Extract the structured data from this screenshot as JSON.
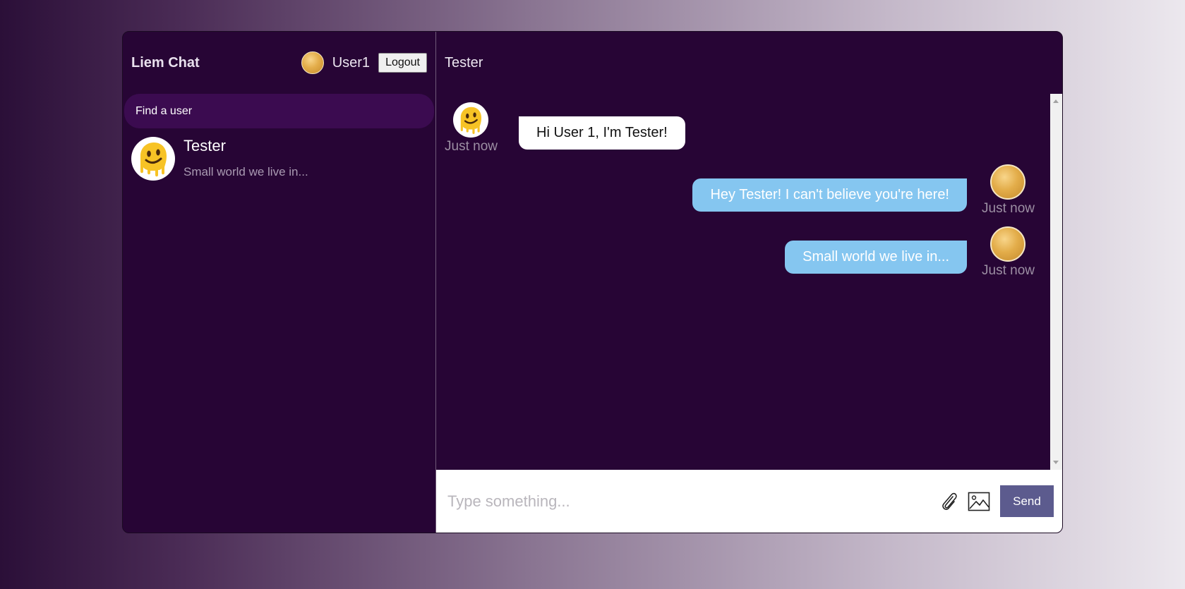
{
  "app": {
    "title": "Liem Chat"
  },
  "current_user": {
    "name": "User1",
    "logout_label": "Logout"
  },
  "search": {
    "placeholder": "Find a user"
  },
  "chats": [
    {
      "name": "Tester",
      "last_message": "Small world we live in..."
    }
  ],
  "active_chat": {
    "name": "Tester"
  },
  "messages": [
    {
      "from": "Tester",
      "owner": false,
      "text": "Hi User 1, I'm Tester!",
      "time": "Just now"
    },
    {
      "from": "User1",
      "owner": true,
      "text": "Hey Tester! I can't believe you're here!",
      "time": "Just now"
    },
    {
      "from": "User1",
      "owner": true,
      "text": "Small world we live in...",
      "time": "Just now"
    }
  ],
  "composer": {
    "placeholder": "Type something...",
    "send_label": "Send"
  },
  "icons": [
    "paperclip-icon",
    "image-icon",
    "melting-face-icon"
  ],
  "colors": {
    "panel": "#270535",
    "search_bg": "#3b0b50",
    "own_bubble": "#85c6f0",
    "other_bubble": "#ffffff",
    "send_button": "#5c5b8e"
  }
}
